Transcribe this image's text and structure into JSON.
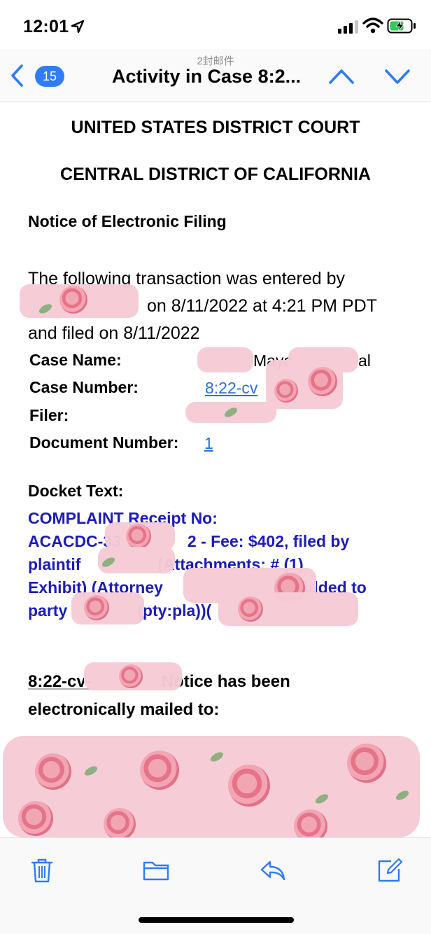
{
  "status_bar": {
    "time": "12:01",
    "icons": [
      "location-arrow-icon",
      "cellular-signal-icon",
      "wifi-icon",
      "battery-charging-icon"
    ]
  },
  "nav": {
    "thread_count": "2封邮件",
    "unread_badge": "15",
    "title": "Activity in Case 8:2...",
    "icons": [
      "chevron-left-icon",
      "chevron-up-icon",
      "chevron-down-icon"
    ]
  },
  "email": {
    "court_line_1": "UNITED STATES DISTRICT COURT",
    "court_line_2": "CENTRAL DISTRICT OF CALIFORNIA",
    "notice_title": "Notice of Electronic Filing",
    "intro_text_1": "The following transaction was entered by",
    "intro_text_2": "on 8/11/2022 at 4:21 PM PDT",
    "intro_text_3": "and filed on 8/11/2022",
    "fields": {
      "case_name_label": "Case Name:",
      "case_name_value": "Mayo",
      "case_name_suffix": "al",
      "case_number_label": "Case Number:",
      "case_number_value": "8:22-cv",
      "filer_label": "Filer:",
      "document_number_label": "Document Number:",
      "document_number_value": "1"
    },
    "docket_label": "Docket Text:",
    "docket_text": {
      "line1": "COMPLAINT Receipt No:",
      "line2a": "ACACDC-33",
      "line2b": "2 - Fee: $402, filed by",
      "line3a": "plaintif",
      "line3b": "(Attachments: # (1)",
      "line4a": "Exhibit) (Attorney",
      "line4b": "added to",
      "line5a": "party",
      "line5b": "(pty:pla))("
    },
    "mailed": {
      "case_ref": "8:22-cv-",
      "text_1": "Notice has been",
      "text_2": "electronically mailed to:"
    }
  },
  "colors": {
    "accent": "#2e7cf6",
    "docket_text": "#1c1cb8",
    "redaction_pink": "#f6cbd6"
  },
  "toolbar": {
    "icons": [
      "trash-icon",
      "folder-icon",
      "reply-icon",
      "compose-icon"
    ]
  }
}
